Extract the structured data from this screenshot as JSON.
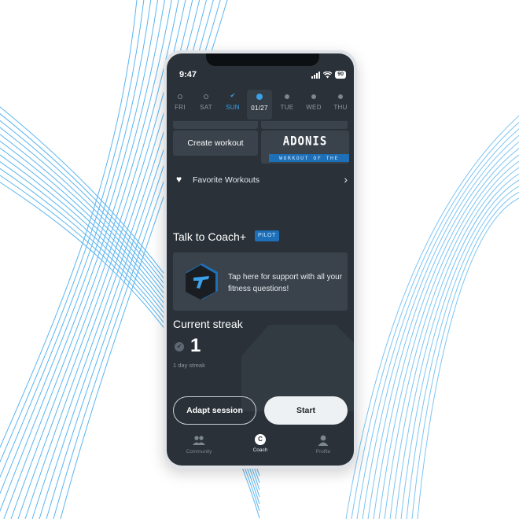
{
  "status_bar": {
    "time": "9:47",
    "battery": "90"
  },
  "week": {
    "days": [
      {
        "label": "FRI",
        "state": "empty"
      },
      {
        "label": "SAT",
        "state": "empty"
      },
      {
        "label": "SUN",
        "state": "done"
      },
      {
        "label": "01/27",
        "state": "today"
      },
      {
        "label": "TUE",
        "state": "planned"
      },
      {
        "label": "WED",
        "state": "planned"
      },
      {
        "label": "THU",
        "state": "planned"
      }
    ]
  },
  "workouts": {
    "create_label": "Create workout",
    "workout_of_week": {
      "name": "ADONIS",
      "tag": "WORKOUT OF THE WEEK"
    },
    "favorites_label": "Favorite Workouts"
  },
  "coach": {
    "title": "Talk to Coach+",
    "badge": "PILOT",
    "card_text": "Tap here for support with all your fitness questions!"
  },
  "streak": {
    "title": "Current streak",
    "count": "1",
    "subtitle": "1 day streak"
  },
  "actions": {
    "adapt_label": "Adapt session",
    "start_label": "Start"
  },
  "nav": {
    "items": [
      {
        "label": "Community",
        "icon": "community-icon"
      },
      {
        "label": "Coach",
        "icon": "coach-icon",
        "badge": "C"
      },
      {
        "label": "Profile",
        "icon": "profile-icon"
      }
    ]
  },
  "colors": {
    "accent": "#3aa0e8",
    "background": "#2a3138",
    "card": "#3a434c",
    "badge_blue": "#1d6fb8"
  }
}
